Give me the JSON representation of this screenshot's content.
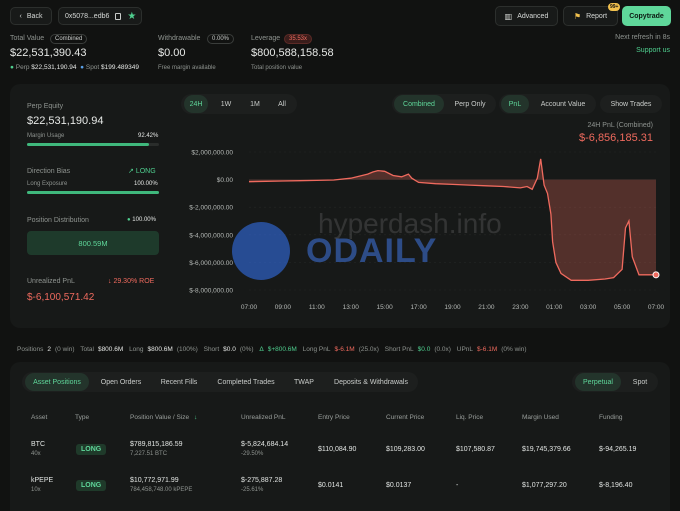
{
  "header": {
    "back_label": "Back",
    "address": "0x5078...edb6",
    "advanced_label": "Advanced",
    "report_label": "Report",
    "report_badge": "99+",
    "copytrade_label": "Copytrade",
    "refresh_text": "Next refresh in 8s",
    "support_label": "Support us"
  },
  "stats": {
    "total_value_label": "Total Value",
    "total_value_tag": "Combined",
    "total_value": "$22,531,390.43",
    "perp_label": "Perp",
    "perp_value": "$22,531,190.94",
    "spot_label": "Spot",
    "spot_value": "$199.489349",
    "withdrawable_label": "Withdrawable",
    "withdrawable_pct": "0.00%",
    "withdrawable_value": "$0.00",
    "withdrawable_sub": "Free margin available",
    "leverage_label": "Leverage",
    "leverage_tag": "35.53x",
    "leverage_value": "$800,588,158.58",
    "leverage_sub": "Total position value"
  },
  "left": {
    "perp_equity_label": "Perp Equity",
    "perp_equity": "$22,531,190.94",
    "margin_usage_label": "Margin Usage",
    "margin_usage": "92.42%",
    "margin_usage_pct": 92.42,
    "direction_label": "Direction Bias",
    "direction_value": "LONG",
    "long_exposure_label": "Long Exposure",
    "long_exposure": "100.00%",
    "long_exposure_pct": 100,
    "distribution_label": "Position Distribution",
    "distribution_pct": "100.00%",
    "distribution_value": "800.59M",
    "upnl_label": "Unrealized PnL",
    "roe": "29.30% ROE",
    "upnl_value": "$-6,100,571.42"
  },
  "chart_controls": {
    "ranges": [
      "24H",
      "1W",
      "1M",
      "All"
    ],
    "modes": [
      "Combined",
      "Perp Only"
    ],
    "metrics": [
      "PnL",
      "Account Value"
    ],
    "show_trades": "Show Trades",
    "pnl_title": "24H PnL (Combined)",
    "pnl_value": "$-6,856,185.31"
  },
  "watermark": {
    "site": "hyperdash.info",
    "brand": "ODAILY"
  },
  "chart_data": {
    "type": "area",
    "title": "24H PnL (Combined)",
    "x_ticks": [
      "07:00",
      "09:00",
      "11:00",
      "13:00",
      "15:00",
      "17:00",
      "19:00",
      "21:00",
      "23:00",
      "01:00",
      "03:00",
      "05:00",
      "07:00"
    ],
    "y_ticks": [
      "$2,000,000.00",
      "$0.00",
      "$-2,000,000.00",
      "$-4,000,000.00",
      "$-6,000,000.00",
      "$-8,000,000.00"
    ],
    "ylim": [
      -8000000,
      2000000
    ],
    "xlim": [
      0,
      24
    ],
    "series": [
      {
        "x": [
          0,
          1,
          2,
          3,
          4,
          5,
          6,
          7,
          7.3,
          7.6,
          8,
          8.5,
          9,
          9.4,
          9.6,
          10,
          11,
          12,
          13,
          14,
          15,
          16,
          16.4,
          16.7,
          17,
          17.2,
          17.4,
          17.6,
          17.8,
          17.9,
          18.1,
          18.4,
          19,
          20,
          21,
          21.5,
          22,
          22.2,
          22.4,
          22.6,
          23,
          24
        ],
        "y": [
          -150000,
          -120000,
          -100000,
          -80000,
          -60000,
          -30000,
          100000,
          400000,
          550000,
          650000,
          600000,
          300000,
          200000,
          400000,
          100000,
          -200000,
          -300000,
          -350000,
          -400000,
          -450000,
          -500000,
          -600000,
          -500000,
          -700000,
          100000,
          1500000,
          -400000,
          -1000000,
          -2500000,
          -4500000,
          -6000000,
          -6800000,
          -7300000,
          -7300000,
          -7200000,
          -7100000,
          -6500000,
          -3500000,
          -3000000,
          -5600000,
          -6900000,
          -6900000
        ]
      }
    ]
  },
  "summary": {
    "positions_label": "Positions",
    "positions_count": "2",
    "positions_win": "(0 win)",
    "total_label": "Total",
    "total_value": "$800.6M",
    "long_label": "Long",
    "long_value": "$800.6M",
    "long_pct": "(100%)",
    "short_label": "Short",
    "short_value": "$0.0",
    "short_pct": "(0%)",
    "delta_label": "Δ",
    "delta_value": "$+800.6M",
    "long_pnl_label": "Long PnL",
    "long_pnl_value": "$-6.1M",
    "long_pnl_x": "(25.0x)",
    "short_pnl_label": "Short PnL",
    "short_pnl_value": "$0.0",
    "short_pnl_x": "(0.0x)",
    "upnl_label": "UPnL",
    "upnl_value": "$-6.1M",
    "upnl_win": "(0% win)"
  },
  "position_tabs": [
    "Asset Positions",
    "Open Orders",
    "Recent Fills",
    "Completed Trades",
    "TWAP",
    "Deposits & Withdrawals"
  ],
  "market_tabs": [
    "Perpetual",
    "Spot"
  ],
  "table": {
    "headers": [
      "Asset",
      "Type",
      "Position Value / Size",
      "Unrealized PnL",
      "Entry Price",
      "Current Price",
      "Liq. Price",
      "Margin Used",
      "Funding"
    ],
    "rows": [
      {
        "asset": "BTC",
        "lev": "40x",
        "type": "LONG",
        "value": "$789,815,186.59",
        "size": "7,227.51 BTC",
        "pnl": "$-5,824,684.14",
        "pnl_pct": "-29.50%",
        "entry": "$110,084.90",
        "current": "$109,283.00",
        "liq": "$107,580.87",
        "margin": "$19,745,379.66",
        "funding": "$-94,265.19"
      },
      {
        "asset": "kPEPE",
        "lev": "10x",
        "type": "LONG",
        "value": "$10,772,971.99",
        "size": "784,458,748.00 kPEPE",
        "pnl": "$-275,887.28",
        "pnl_pct": "-25.61%",
        "entry": "$0.0141",
        "current": "$0.0137",
        "liq": "-",
        "margin": "$1,077,297.20",
        "funding": "$-8,196.40"
      }
    ]
  },
  "colors": {
    "accent": "#4fcf8f",
    "negative": "#ef6a5e",
    "background": "#111211"
  }
}
